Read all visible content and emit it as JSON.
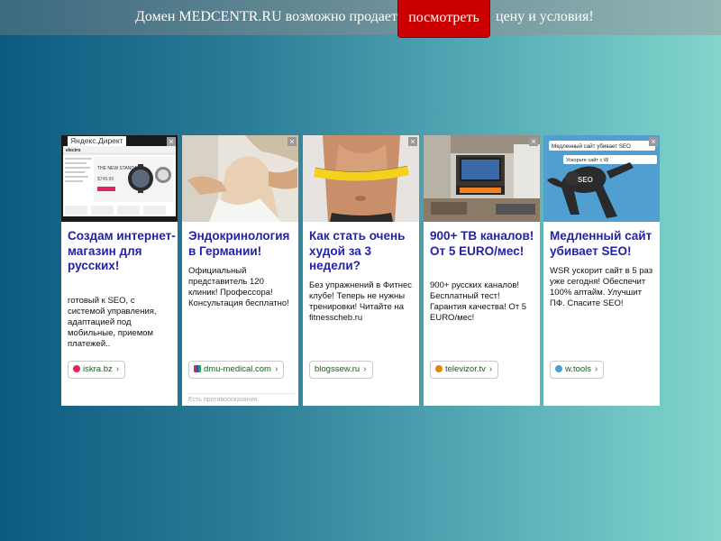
{
  "topbar": {
    "text_before": "Домен MEDCENTR.RU возможно продается,",
    "button_label": "посмотреть",
    "text_after": "цену и условия!"
  },
  "ads": {
    "label": "Яндекс.Директ",
    "close_glyph": "×",
    "cards": [
      {
        "title": "Создам интернет-магазин для русских!",
        "description": "готовый к SEO, с системой управления, адаптацией под мобильные, приемом платежей..",
        "domain": "iskra.bz",
        "favicon_color": "#e0245e"
      },
      {
        "title": "Эндокринология в Германии!",
        "description": "Официальный представитель 120 клиник! Профессора! Консультация бесплатно!",
        "domain": "dmu-medical.com",
        "favicon_color": "#3355cc",
        "footnote": "Есть противопоказания."
      },
      {
        "title": "Как стать очень худой за 3 недели?",
        "description": "Без упражнений в Фитнес клубе! Теперь не нужны тренировки! Читайте на fitnesscheb.ru",
        "domain": "blogssew.ru"
      },
      {
        "title": "900+ ТВ каналов! От 5 EURO/мес!",
        "description": "900+ русских каналов! Бесплатный тест! Гарантия качества! От 5 EURO/мес!",
        "domain": "televizor.tv",
        "favicon_color": "#e08a00"
      },
      {
        "title": "Медленный сайт убивает SEO!",
        "description": "WSR ускорит сайт в 5 раз уже сегодня! Обеспечит 100% аптайм. Улучшит ПФ. Спасите SEO!",
        "domain": "w.tools",
        "favicon_color": "#4aa0d0",
        "banner_text_1": "Медленный сайт убивает SEO",
        "banner_text_2": "Ускорьте сайт с W"
      }
    ],
    "shop_banner": {
      "brand": "electro",
      "headline": "THE NEW STANDARD",
      "price": "$749.99"
    }
  }
}
